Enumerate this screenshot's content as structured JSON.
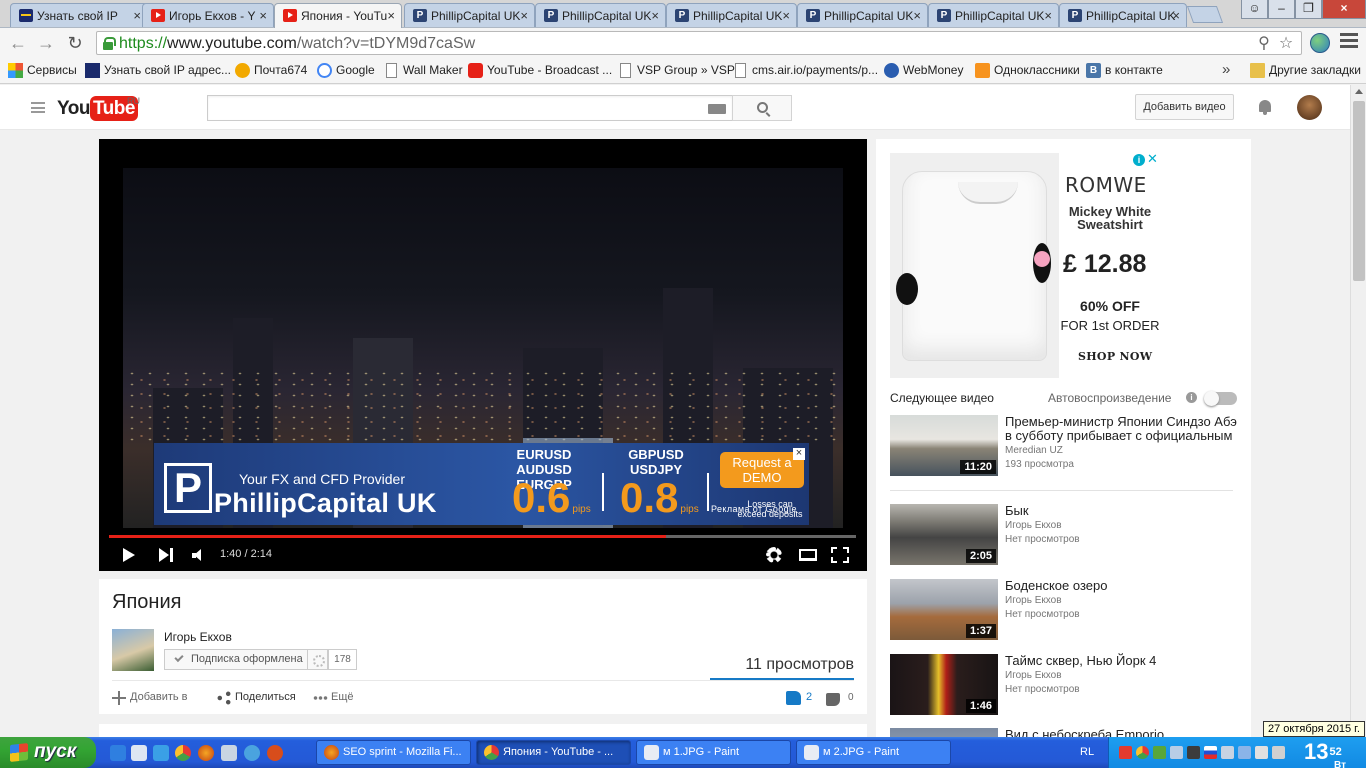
{
  "browser": {
    "tabs": [
      {
        "title": "Узнать свой IP",
        "favicon": "ip-icon"
      },
      {
        "title": "Игорь Екхов - Y",
        "favicon": "youtube-icon"
      },
      {
        "title": "Япония - YouTu",
        "favicon": "youtube-icon",
        "active": true
      },
      {
        "title": "PhillipCapital UK",
        "favicon": "phillipcapital-icon"
      },
      {
        "title": "PhillipCapital UK",
        "favicon": "phillipcapital-icon"
      },
      {
        "title": "PhillipCapital UK",
        "favicon": "phillipcapital-icon"
      },
      {
        "title": "PhillipCapital UK",
        "favicon": "phillipcapital-icon"
      },
      {
        "title": "PhillipCapital UK",
        "favicon": "phillipcapital-icon"
      },
      {
        "title": "PhillipCapital UK",
        "favicon": "phillipcapital-icon"
      }
    ],
    "url": {
      "scheme": "https://",
      "host": "www.youtube.com",
      "path": "/watch?v=tDYM9d7caSw"
    },
    "bookmarks": [
      {
        "label": "Сервисы",
        "icon": "apps-icon"
      },
      {
        "label": "Узнать свой IP адрес...",
        "icon": "ip-icon"
      },
      {
        "label": "Почта674",
        "icon": "mail-icon"
      },
      {
        "label": "Google",
        "icon": "google-icon"
      },
      {
        "label": "Wall Maker",
        "icon": "page-icon"
      },
      {
        "label": "YouTube - Broadcast ...",
        "icon": "youtube-icon"
      },
      {
        "label": "VSP Group » VSP",
        "icon": "page-icon"
      },
      {
        "label": "cms.air.io/payments/p...",
        "icon": "page-icon"
      },
      {
        "label": "WebMoney",
        "icon": "webmoney-icon"
      },
      {
        "label": "Одноклассники",
        "icon": "odnoklassniki-icon"
      },
      {
        "label": "в контакте",
        "icon": "vk-icon"
      }
    ],
    "bookmarks_more": "»",
    "other_bookmarks": "Другие закладки"
  },
  "youtube": {
    "logo": {
      "you": "You",
      "tube": "Tube",
      "region": "RU"
    },
    "upload_label": "Добавить видео",
    "player": {
      "current_time": "1:40",
      "duration": "2:14",
      "time_display": "1:40 / 2:14",
      "progress": 0.746,
      "ad": {
        "tagline": "Your FX and CFD Provider",
        "brand": "PhillipCapital UK",
        "pairs_a": "EURUSD  AUDUSD\nEURGBP",
        "pips_a": "0.6",
        "pairs_b": "GBPUSD\nUSDJPY",
        "pips_b": "0.8",
        "pips_unit": "pips",
        "demo": "Request a DEMO",
        "risk": "Losses can exceed deposits",
        "close": "×",
        "google_label": "Реклама от Google"
      }
    },
    "video": {
      "title": "Япония",
      "channel": "Игорь Екхов",
      "subscribe_label": "Подписка оформлена",
      "subscriber_count": "178",
      "views": "11 просмотров",
      "actions": {
        "add": "Добавить в",
        "share": "Поделиться",
        "more": "Ещё"
      },
      "likes": "2",
      "dislikes": "0"
    },
    "sidebar_ad": {
      "brand": "ROMWE",
      "product": "Mickey White Sweatshirt",
      "price": "£ 12.88",
      "discount_a": "60% OFF",
      "discount_b": "FOR 1st ORDER",
      "cta": "SHOP NOW"
    },
    "up_next_label": "Следующее видео",
    "autoplay_label": "Автовоспроизведение",
    "autoplay_on": false,
    "related": [
      {
        "title": "Премьер-министр Японии Синдзо Абэ в субботу прибывает с официальным",
        "channel": "Meredian UZ",
        "views": "193 просмотра",
        "duration": "11:20"
      },
      {
        "title": "Бык",
        "channel": "Игорь Екхов",
        "views": "Нет просмотров",
        "duration": "2:05"
      },
      {
        "title": "Боденское озеро",
        "channel": "Игорь Екхов",
        "views": "Нет просмотров",
        "duration": "1:37"
      },
      {
        "title": "Таймс сквер, Нью Йорк 4",
        "channel": "Игорь Екхов",
        "views": "Нет просмотров",
        "duration": "1:46"
      },
      {
        "title": "Вид с небоскреба Emporio",
        "channel": "",
        "views": "",
        "duration": ""
      }
    ]
  },
  "taskbar": {
    "start_label": "пуск",
    "windows": [
      {
        "label": "SEO sprint - Mozilla Fi...",
        "icon": "firefox-icon"
      },
      {
        "label": "Япония - YouTube - ...",
        "icon": "chrome-icon",
        "active": true
      },
      {
        "label": "м 1.JPG - Paint",
        "icon": "paint-icon"
      },
      {
        "label": "м 2.JPG - Paint",
        "icon": "paint-icon"
      }
    ],
    "language": "RL",
    "clock_hour": "13",
    "clock_min": "52",
    "clock_day": "Вт",
    "date_tooltip": "27 октября 2015 г."
  },
  "colors": {
    "youtube_red": "#e62117",
    "link_blue": "#167ac6",
    "ad_orange": "#f39a1d",
    "taskbar_blue": "#245edc",
    "start_green": "#33a533"
  }
}
